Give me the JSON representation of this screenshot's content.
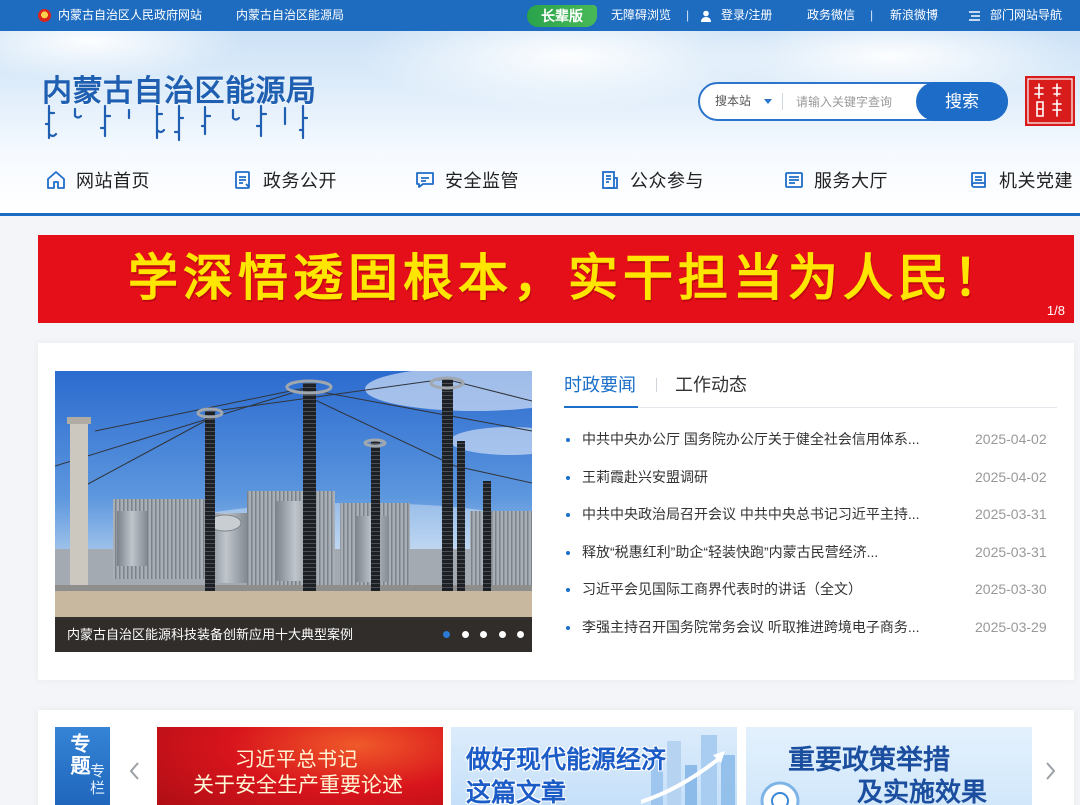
{
  "top_bar": {
    "gov_site": "内蒙古自治区人民政府网站",
    "bureau_site": "内蒙古自治区能源局",
    "elder_mode": "长辈版",
    "accessibility": "无障碍浏览",
    "separator": "|",
    "login": "登录/注册",
    "wechat": "政务微信",
    "weibo": "新浪微博",
    "dept_nav": "部门网站导航"
  },
  "header": {
    "logo_title": "内蒙古自治区能源局",
    "search": {
      "scope": "搜本站",
      "placeholder": "请输入关键字查询",
      "button": "搜索"
    }
  },
  "nav": {
    "items": [
      {
        "label": "网站首页",
        "icon": "home-icon"
      },
      {
        "label": "政务公开",
        "icon": "document-icon"
      },
      {
        "label": "安全监管",
        "icon": "chat-icon"
      },
      {
        "label": "公众参与",
        "icon": "list-icon"
      },
      {
        "label": "服务大厅",
        "icon": "id-card-icon"
      },
      {
        "label": "机关党建",
        "icon": "book-icon"
      }
    ]
  },
  "banner": {
    "text": "学深悟透固根本，实干担当为人民！",
    "pager": "1/8"
  },
  "carousel": {
    "caption": "内蒙古自治区能源科技装备创新应用十大典型案例",
    "slide_count": 5,
    "active_slide": 0
  },
  "news": {
    "tabs": [
      {
        "label": "时政要闻",
        "active": true
      },
      {
        "label": "工作动态",
        "active": false
      }
    ],
    "items": [
      {
        "title": "中共中央办公厅 国务院办公厅关于健全社会信用体系...",
        "date": "2025-04-02"
      },
      {
        "title": "王莉霞赴兴安盟调研",
        "date": "2025-04-02"
      },
      {
        "title": "中共中央政治局召开会议 中共中央总书记习近平主持...",
        "date": "2025-03-31"
      },
      {
        "title": "释放“税惠红利”助企“轻装快跑”内蒙古民营经济...",
        "date": "2025-03-31"
      },
      {
        "title": "习近平会见国际工商界代表时的讲话（全文）",
        "date": "2025-03-30"
      },
      {
        "title": "李强主持召开国务院常务会议 听取推进跨境电子商务...",
        "date": "2025-03-29"
      }
    ]
  },
  "topics": {
    "label": [
      "专题",
      "专栏"
    ],
    "cards": [
      {
        "line1": "习近平总书记",
        "line2": "关于安全生产重要论述"
      },
      {
        "line1": "做好现代能源经济",
        "line2": "这篇文章"
      },
      {
        "line1": "重要政策举措",
        "line2": "及实施效果"
      }
    ]
  },
  "colors": {
    "primary_blue": "#1e6cc0",
    "elder_green": "#2aa34c",
    "banner_red": "#e50f1a",
    "banner_text": "#ffe600",
    "date_gray": "#999999"
  }
}
